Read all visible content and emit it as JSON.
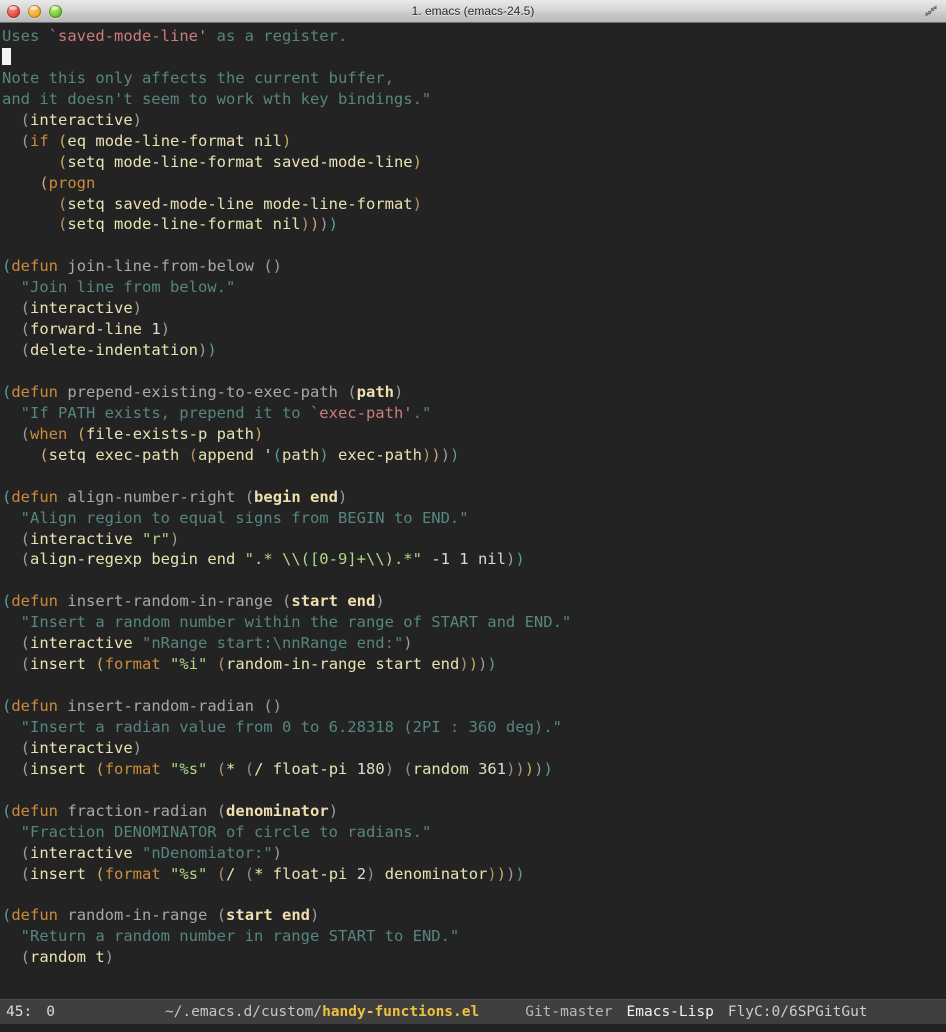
{
  "window": {
    "title": "1. emacs (emacs-24.5)",
    "controls": {
      "close": "close-button",
      "minimize": "minimize-button",
      "zoom": "zoom-button",
      "fullscreen": "fullscreen-icon"
    }
  },
  "colors": {
    "background": "#232323",
    "foreground": "#d0d0d0",
    "keyword": "#cc8b3a",
    "docstring": "#56867f",
    "string": "#afd787",
    "argument": "#f0dfaf",
    "modeline_bg": "#3f3f3f",
    "modeline_file": "#f0c040",
    "cursor": "#f4f4f4"
  },
  "buffer": {
    "lines": [
      "Uses `saved-mode-line' as a register.",
      "",
      "Note this only affects the current buffer,",
      "and it doesn't seem to work wth key bindings.\"",
      "  (interactive)",
      "  (if (eq mode-line-format nil)",
      "      (setq mode-line-format saved-mode-line)",
      "    (progn",
      "      (setq saved-mode-line mode-line-format)",
      "      (setq mode-line-format nil))))",
      "",
      "(defun join-line-from-below ()",
      "  \"Join line from below.\"",
      "  (interactive)",
      "  (forward-line 1)",
      "  (delete-indentation))",
      "",
      "(defun prepend-existing-to-exec-path (path)",
      "  \"If PATH exists, prepend it to `exec-path'.\"",
      "  (when (file-exists-p path)",
      "    (setq exec-path (append '(path) exec-path))))",
      "",
      "(defun align-number-right (begin end)",
      "  \"Align region to equal signs from BEGIN to END.\"",
      "  (interactive \"r\")",
      "  (align-regexp begin end \".* \\\\([0-9]+\\\\).*\" -1 1 nil))",
      "",
      "(defun insert-random-in-range (start end)",
      "  \"Insert a random number within the range of START and END.\"",
      "  (interactive \"nRange start:\\nnRange end:\")",
      "  (insert (format \"%i\" (random-in-range start end))))",
      "",
      "(defun insert-random-radian ()",
      "  \"Insert a radian value from 0 to 6.28318 (2PI : 360 deg).\"",
      "  (interactive)",
      "  (insert (format \"%s\" (* (/ float-pi 180) (random 361)))))",
      "",
      "(defun fraction-radian (denominator)",
      "  \"Fraction DENOMINATOR of circle to radians.\"",
      "  (interactive \"nDenomiator:\")",
      "  (insert (format \"%s\" (/ (* float-pi 2) denominator))))",
      "",
      "(defun random-in-range (start end)",
      "  \"Return a random number in range START to END.\"",
      "  (random t)"
    ],
    "cursor_line_index": 1
  },
  "mode_line": {
    "line_number": "45:",
    "column_number": "0",
    "directory": "~/.emacs.d/custom/",
    "file_name": "handy-functions.el",
    "vc_status": "Git-master",
    "major_mode": "Emacs-Lisp",
    "flycheck": "FlyC:0/6",
    "smartparens": "SP",
    "git_gutter": "GitGut"
  }
}
